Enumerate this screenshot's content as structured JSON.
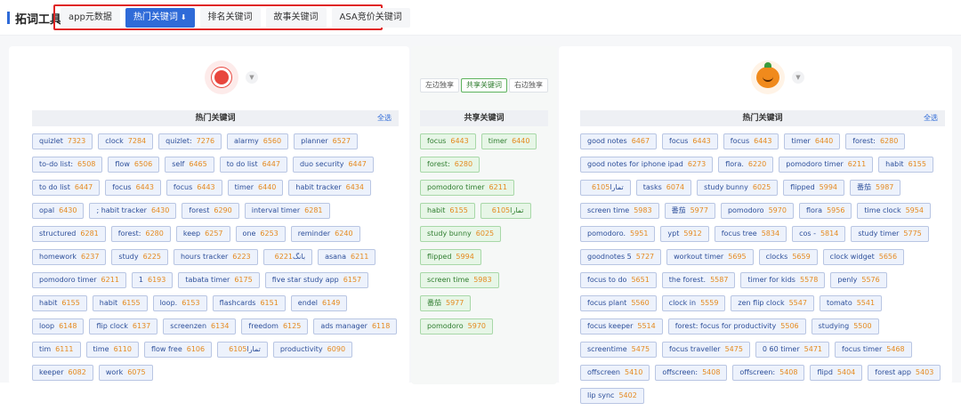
{
  "brand": {
    "title": "拓词工具"
  },
  "tabs": [
    {
      "label": "app元数据",
      "active": false
    },
    {
      "label": "热门关键词",
      "active": true
    },
    {
      "label": "排名关键词",
      "active": false
    },
    {
      "label": "故事关键词",
      "active": false
    },
    {
      "label": "ASA竞价关键词",
      "active": false
    }
  ],
  "toggle": [
    "左边独享",
    "共享关键词",
    "右边独享"
  ],
  "left": {
    "header": "热门关键词",
    "select_all": "全选",
    "chips": [
      {
        "w": "quizlet",
        "n": "7323"
      },
      {
        "w": "clock",
        "n": "7284"
      },
      {
        "w": "quizlet:",
        "n": "7276"
      },
      {
        "w": "alarmy",
        "n": "6560"
      },
      {
        "w": "planner",
        "n": "6527"
      },
      {
        "w": "to-do list:",
        "n": "6508"
      },
      {
        "w": "flow",
        "n": "6506"
      },
      {
        "w": "self",
        "n": "6465"
      },
      {
        "w": "to do list",
        "n": "6447"
      },
      {
        "w": "duo security",
        "n": "6447"
      },
      {
        "w": "to do list",
        "n": "6447"
      },
      {
        "w": "focus",
        "n": "6443"
      },
      {
        "w": "focus",
        "n": "6443"
      },
      {
        "w": "timer",
        "n": "6440"
      },
      {
        "w": "habit tracker",
        "n": "6434"
      },
      {
        "w": "opal",
        "n": "6430"
      },
      {
        "w": "; habit tracker",
        "n": "6430"
      },
      {
        "w": "forest",
        "n": "6290"
      },
      {
        "w": "interval timer",
        "n": "6281"
      },
      {
        "w": "structured",
        "n": "6281"
      },
      {
        "w": "forest:",
        "n": "6280"
      },
      {
        "w": "keep",
        "n": "6257"
      },
      {
        "w": "one",
        "n": "6253"
      },
      {
        "w": "reminder",
        "n": "6240"
      },
      {
        "w": "homework",
        "n": "6237"
      },
      {
        "w": "study",
        "n": "6225"
      },
      {
        "w": "hours tracker",
        "n": "6223"
      },
      {
        "w": "بانگ",
        "n": "6221"
      },
      {
        "w": "asana",
        "n": "6211"
      },
      {
        "w": "pomodoro timer",
        "n": "6211"
      },
      {
        "w": "1",
        "n": "6193"
      },
      {
        "w": "tabata timer",
        "n": "6175"
      },
      {
        "w": "five star study app",
        "n": "6157"
      },
      {
        "w": "habit",
        "n": "6155"
      },
      {
        "w": "habit",
        "n": "6155"
      },
      {
        "w": "loop.",
        "n": "6153"
      },
      {
        "w": "flashcards",
        "n": "6151"
      },
      {
        "w": "endel",
        "n": "6149"
      },
      {
        "w": "loop",
        "n": "6148"
      },
      {
        "w": "flip clock",
        "n": "6137"
      },
      {
        "w": "screenzen",
        "n": "6134"
      },
      {
        "w": "freedom",
        "n": "6125"
      },
      {
        "w": "ads manager",
        "n": "6118"
      },
      {
        "w": "tim",
        "n": "6111"
      },
      {
        "w": "time",
        "n": "6110"
      },
      {
        "w": "flow free",
        "n": "6106"
      },
      {
        "w": "تمارا",
        "n": "6105"
      },
      {
        "w": "productivity",
        "n": "6090"
      },
      {
        "w": "keeper",
        "n": "6082"
      },
      {
        "w": "work",
        "n": "6075"
      }
    ]
  },
  "mid": {
    "header": "共享关键词",
    "chips": [
      {
        "w": "focus",
        "n": "6443"
      },
      {
        "w": "timer",
        "n": "6440"
      },
      {
        "w": "forest:",
        "n": "6280"
      },
      {
        "w": "pomodoro timer",
        "n": "6211"
      },
      {
        "w": "habit",
        "n": "6155"
      },
      {
        "w": "تمارا",
        "n": "6105"
      },
      {
        "w": "study bunny",
        "n": "6025"
      },
      {
        "w": "flipped",
        "n": "5994"
      },
      {
        "w": "screen time",
        "n": "5983"
      },
      {
        "w": "番茄",
        "n": "5977"
      },
      {
        "w": "pomodoro",
        "n": "5970"
      }
    ]
  },
  "right": {
    "header": "热门关键词",
    "select_all": "全选",
    "chips": [
      {
        "w": "good notes",
        "n": "6467"
      },
      {
        "w": "focus",
        "n": "6443"
      },
      {
        "w": "focus",
        "n": "6443"
      },
      {
        "w": "timer",
        "n": "6440"
      },
      {
        "w": "forest:",
        "n": "6280"
      },
      {
        "w": "good notes for iphone ipad",
        "n": "6273"
      },
      {
        "w": "flora.",
        "n": "6220"
      },
      {
        "w": "pomodoro timer",
        "n": "6211"
      },
      {
        "w": "habit",
        "n": "6155"
      },
      {
        "w": "تمارا",
        "n": "6105"
      },
      {
        "w": "tasks",
        "n": "6074"
      },
      {
        "w": "study bunny",
        "n": "6025"
      },
      {
        "w": "flipped",
        "n": "5994"
      },
      {
        "w": "番茄",
        "n": "5987"
      },
      {
        "w": "screen time",
        "n": "5983"
      },
      {
        "w": "番茄",
        "n": "5977"
      },
      {
        "w": "pomodoro",
        "n": "5970"
      },
      {
        "w": "flora",
        "n": "5956"
      },
      {
        "w": "time clock",
        "n": "5954"
      },
      {
        "w": "pomodoro.",
        "n": "5951"
      },
      {
        "w": "ypt",
        "n": "5912"
      },
      {
        "w": "focus tree",
        "n": "5834"
      },
      {
        "w": "cos -",
        "n": "5814"
      },
      {
        "w": "study timer",
        "n": "5775"
      },
      {
        "w": "goodnotes 5",
        "n": "5727"
      },
      {
        "w": "workout timer",
        "n": "5695"
      },
      {
        "w": "clocks",
        "n": "5659"
      },
      {
        "w": "clock widget",
        "n": "5656"
      },
      {
        "w": "focus to do",
        "n": "5651"
      },
      {
        "w": "the forest.",
        "n": "5587"
      },
      {
        "w": "timer for kids",
        "n": "5578"
      },
      {
        "w": "penly",
        "n": "5576"
      },
      {
        "w": "focus plant",
        "n": "5560"
      },
      {
        "w": "clock in",
        "n": "5559"
      },
      {
        "w": "zen flip clock",
        "n": "5547"
      },
      {
        "w": "tomato",
        "n": "5541"
      },
      {
        "w": "focus keeper",
        "n": "5514"
      },
      {
        "w": "forest: focus for productivity",
        "n": "5506"
      },
      {
        "w": "studying",
        "n": "5500"
      },
      {
        "w": "screentime",
        "n": "5475"
      },
      {
        "w": "focus traveller",
        "n": "5475"
      },
      {
        "w": "0 60 timer",
        "n": "5471"
      },
      {
        "w": "focus timer",
        "n": "5468"
      },
      {
        "w": "offscreen",
        "n": "5410"
      },
      {
        "w": "offscreen:",
        "n": "5408"
      },
      {
        "w": "offscreen:",
        "n": "5408"
      },
      {
        "w": "flipd",
        "n": "5404"
      },
      {
        "w": "forest app",
        "n": "5403"
      },
      {
        "w": "lip sync",
        "n": "5402"
      }
    ]
  }
}
